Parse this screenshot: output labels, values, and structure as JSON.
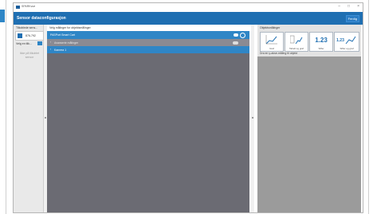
{
  "window": {
    "app_title": "SPARKvue",
    "page_title": "Sensor dataconfigurasjon",
    "done_button": "Ferdig"
  },
  "sidebar": {
    "header": "Tilkoblede sens...",
    "device_label": "876-792",
    "add_label": "Velg en tilk...",
    "hint": "Ikke på tilkoblet sensor"
  },
  "middle": {
    "header": "Velg målinger for objektsmålinger",
    "sensor_row": "PASPort Smart Cart",
    "sub_row": "Avanserte målinger",
    "camera_row": "Kamera 1"
  },
  "right": {
    "header": "Objektsmålinger",
    "tiles": [
      {
        "label": "Graf",
        "icon": "line-graph-icon"
      },
      {
        "label": "Tabell og graf",
        "icon": "table-graph-icon"
      },
      {
        "label": "Siffer",
        "value": "1.23"
      },
      {
        "label": "Siffer og graf",
        "value": "1.23"
      }
    ],
    "drag_label": "Dra en y-akse-måling til objekt"
  },
  "colors": {
    "header": "#1f6fb2",
    "accent": "#2f86c6"
  }
}
